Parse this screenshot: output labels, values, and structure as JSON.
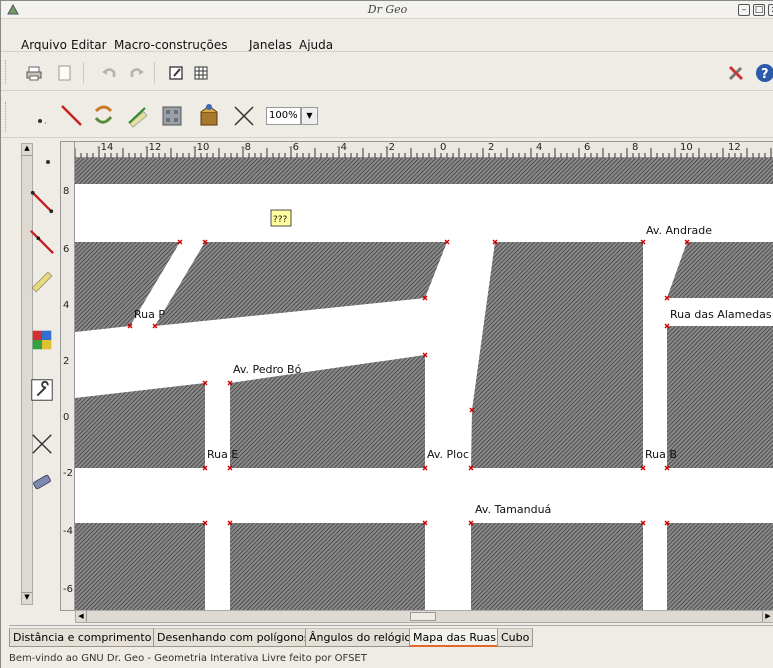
{
  "window": {
    "title": "Dr Geo",
    "icon": "drgeo-app-icon",
    "controls": [
      "minimize",
      "maximize",
      "close"
    ]
  },
  "menubar": {
    "items": [
      {
        "label": "Arquivo",
        "mnemonic": "A"
      },
      {
        "label": "Editar",
        "mnemonic": "E"
      },
      {
        "label": "Macro-construções",
        "mnemonic": "M"
      },
      {
        "label": "Janelas",
        "mnemonic": "J"
      },
      {
        "label": "Ajuda",
        "mnemonic": "u"
      }
    ]
  },
  "toolbar_main": {
    "icons": [
      "print-icon",
      "new-page-icon",
      "undo-icon",
      "redo-icon",
      "edit-icon",
      "grid-icon"
    ],
    "right_icons": [
      "tools-icon",
      "help-icon"
    ]
  },
  "toolbar_construct": {
    "icons": [
      "point-icon",
      "line-icon",
      "transformation-icon",
      "numeric-icon",
      "macro-icon",
      "script-icon",
      "delete-icon"
    ],
    "zoom": "100%"
  },
  "left_tools": {
    "icons": [
      "point-tool-icon",
      "segment-tool-icon",
      "line-tool-icon",
      "ruler-tool-icon",
      "style-tool-icon",
      "properties-tool-icon",
      "move-tool-icon",
      "eraser-tool-icon"
    ]
  },
  "ruler": {
    "h_labels": [
      "-14",
      "-12",
      "-10",
      "-8",
      "-6",
      "-4",
      "-2",
      "0",
      "2",
      "4",
      "6",
      "8",
      "10",
      "12"
    ],
    "v_labels": [
      "8",
      "6",
      "4",
      "2",
      "0",
      "-2",
      "-4",
      "-6"
    ]
  },
  "drawing": {
    "labels": {
      "unknown": "???",
      "av_andrade": "Av. Andrade",
      "rua_p": "Rua P",
      "rua_das_alamedas": "Rua das Alamedas",
      "av_pedro_bo": "Av. Pedro Bó",
      "rua_e": "Rua E",
      "av_ploc": "Av. Ploc",
      "rua_b": "Rua B",
      "av_tamandua": "Av. Tamanduá"
    },
    "colors": {
      "block_fill": "#5a5a5a",
      "point_marker": "#cc0000",
      "road": "#ffffff"
    }
  },
  "tabs": [
    {
      "label": "Distância e comprimento",
      "active": false
    },
    {
      "label": "Desenhando com polígonos",
      "active": false
    },
    {
      "label": "Ângulos do relógio",
      "active": false
    },
    {
      "label": "Mapa das Ruas",
      "active": true
    },
    {
      "label": "Cubo",
      "active": false
    }
  ],
  "status": "Bem-vindo ao GNU Dr. Geo - Geometria Interativa Livre feito por OFSET"
}
